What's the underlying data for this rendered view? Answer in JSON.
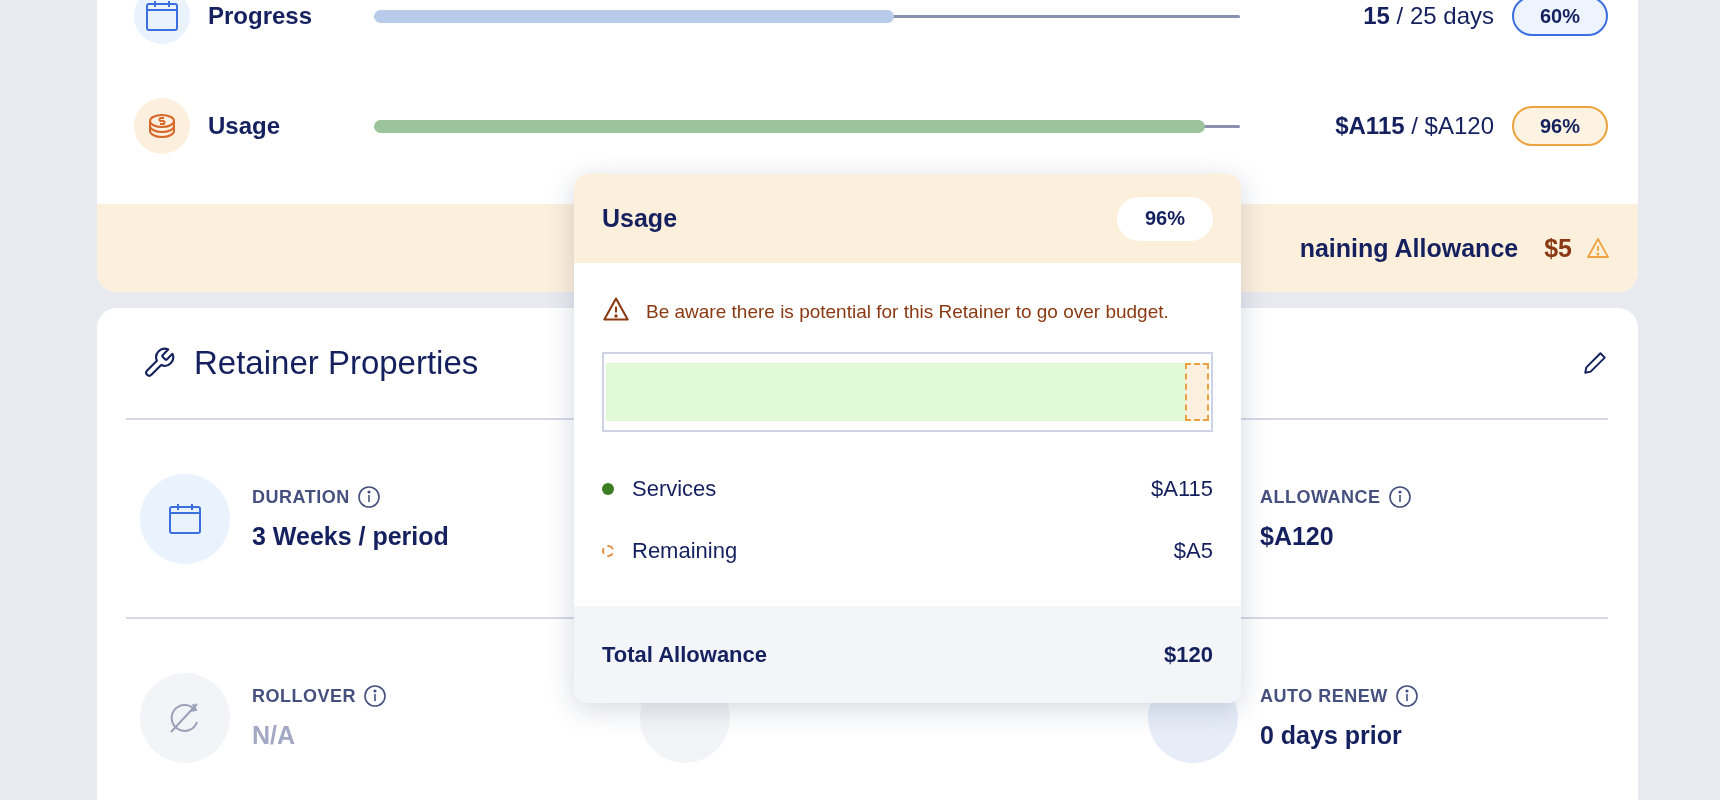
{
  "meters": [
    {
      "kind": "time",
      "label": "Progress",
      "level": 0.6,
      "reading": "**15** / 25 days",
      "badge": "60%"
    },
    {
      "kind": "budget",
      "label": "Usage",
      "level": 0.96,
      "reading": "**$A115** / $A120",
      "badge": "96%"
    }
  ],
  "banner": {
    "label": "naining Allowance",
    "value": "$5"
  },
  "properties": {
    "title": "Retainer Properties",
    "rows": [
      {
        "cells": [
          {
            "kind": "calendar",
            "label": "DURATION",
            "value": "3 Weeks / period",
            "disabled": false
          },
          {
            "kind": "hidden"
          },
          {
            "kind": "hidden",
            "label": "ALLOWANCE",
            "value": "$A120",
            "disabled": false
          }
        ]
      },
      {
        "cells": [
          {
            "kind": "rollover",
            "label": "ROLLOVER",
            "value": "N/A",
            "disabled": true
          },
          {
            "kind": "grey"
          },
          {
            "kind": "blue",
            "label": "AUTO RENEW",
            "value": "0 days prior",
            "disabled": false
          }
        ]
      }
    ]
  },
  "popover": {
    "title": "Usage",
    "badge": "96%",
    "warning": "Be aware there is potential for this Retainer to go over budget.",
    "level": 0.96,
    "legend": [
      {
        "kind": "solid",
        "label": "Services",
        "value": "$A115",
        "color": "#3a7d22"
      },
      {
        "kind": "dashed",
        "label": "Remaining",
        "value": "$A5",
        "color": "#e08a3c"
      }
    ],
    "footer": {
      "label": "Total Allowance",
      "value": "$120"
    }
  }
}
